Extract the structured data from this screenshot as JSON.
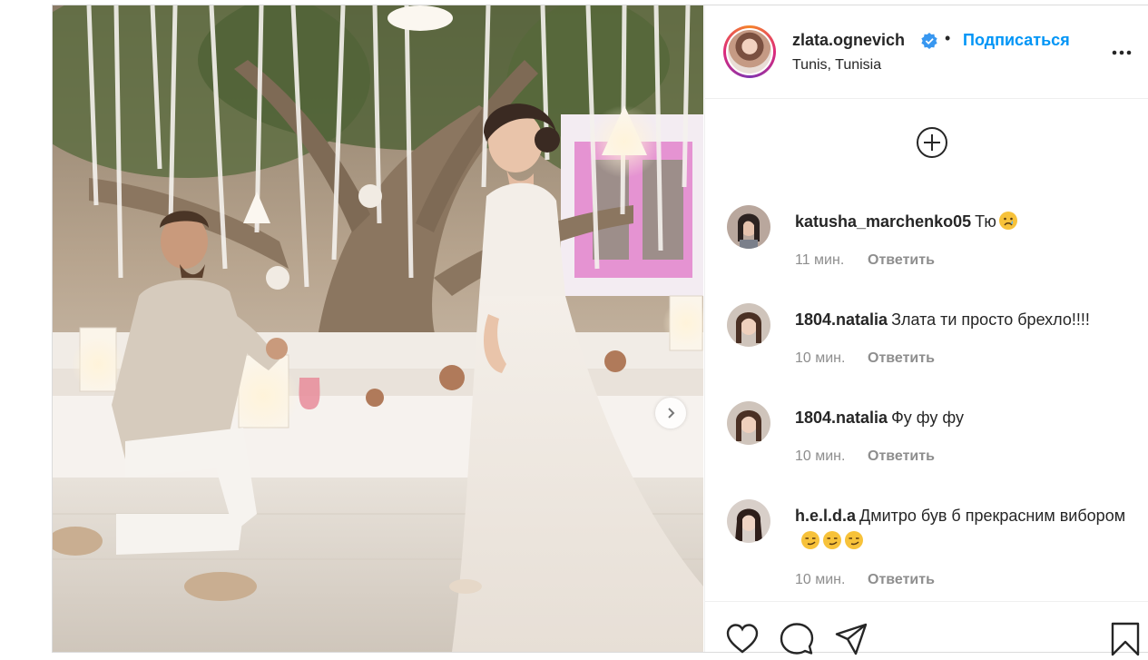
{
  "post": {
    "image_alt": "Man kneeling and proposing to woman in white dress under a tree with hanging ribbons and lanterns"
  },
  "header": {
    "username": "zlata.ognevich",
    "verified": true,
    "separator": "•",
    "follow_label": "Подписаться",
    "location": "Tunis, Tunisia",
    "more_icon": "more-dots-icon",
    "follow_color": "#0095f6"
  },
  "comments": [
    {
      "username": "katusha_marchenko05",
      "text": "Тю",
      "emojis": [
        "sad-face"
      ],
      "time": "11 мин.",
      "reply_label": "Ответить"
    },
    {
      "username": "1804.natalia",
      "text": "Злата ти просто брехло!!!!",
      "emojis": [],
      "time": "10 мин.",
      "reply_label": "Ответить"
    },
    {
      "username": "1804.natalia",
      "text": "Фу фу фу",
      "emojis": [],
      "time": "10 мин.",
      "reply_label": "Ответить"
    },
    {
      "username": "h.e.l.d.a",
      "text": "Дмитро був б прекрасним вибором",
      "emojis": [
        "smirk-face",
        "smirk-face",
        "smirk-face"
      ],
      "time": "10 мин.",
      "reply_label": "Ответить"
    }
  ],
  "actions": {
    "like_icon": "heart-icon",
    "comment_icon": "comment-icon",
    "share_icon": "paper-plane-icon",
    "save_icon": "bookmark-icon"
  }
}
